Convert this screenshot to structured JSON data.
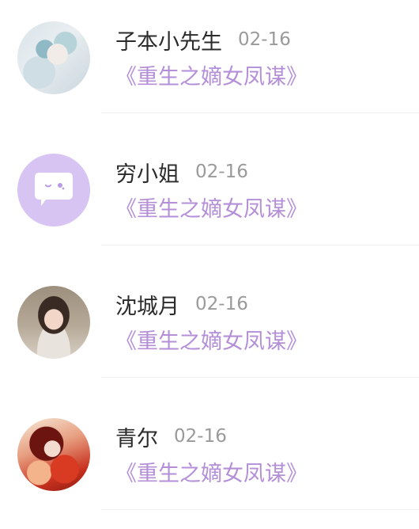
{
  "messages": [
    {
      "name": "子本小先生",
      "date": "02-16",
      "book": "《重生之嫡女凤谋》",
      "avatar": "user-photo-avatar"
    },
    {
      "name": "穷小姐",
      "date": "02-16",
      "book": "《重生之嫡女凤谋》",
      "avatar": "chat-bubble-default-avatar"
    },
    {
      "name": "沈城月",
      "date": "02-16",
      "book": "《重生之嫡女凤谋》",
      "avatar": "user-photo-avatar"
    },
    {
      "name": "青尔",
      "date": "02-16",
      "book": "《重生之嫡女凤谋》",
      "avatar": "user-photo-avatar"
    }
  ],
  "colors": {
    "name": "#2b2b2b",
    "date": "#9a9a9a",
    "book": "#b48fd8",
    "default_avatar_bg": "#d7c4f3"
  }
}
